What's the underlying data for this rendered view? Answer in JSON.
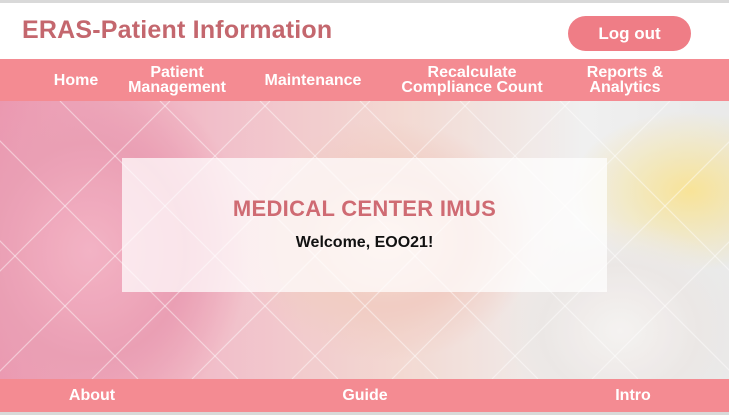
{
  "header": {
    "title": "ERAS-Patient Information",
    "logout_label": "Log out"
  },
  "nav": {
    "items": [
      {
        "label": "Home"
      },
      {
        "label": "Patient\nManagement"
      },
      {
        "label": "Maintenance"
      },
      {
        "label": "Recalculate\nCompliance Count"
      },
      {
        "label": "Reports &\nAnalytics"
      }
    ]
  },
  "hero": {
    "card_title": "MEDICAL CENTER IMUS",
    "welcome": "Welcome, EOO21!"
  },
  "footer": {
    "items": [
      {
        "label": "About"
      },
      {
        "label": "Guide"
      },
      {
        "label": "Intro"
      }
    ]
  },
  "colors": {
    "accent": "#f48b92",
    "title": "#c4676e",
    "button": "#ef7d86"
  }
}
